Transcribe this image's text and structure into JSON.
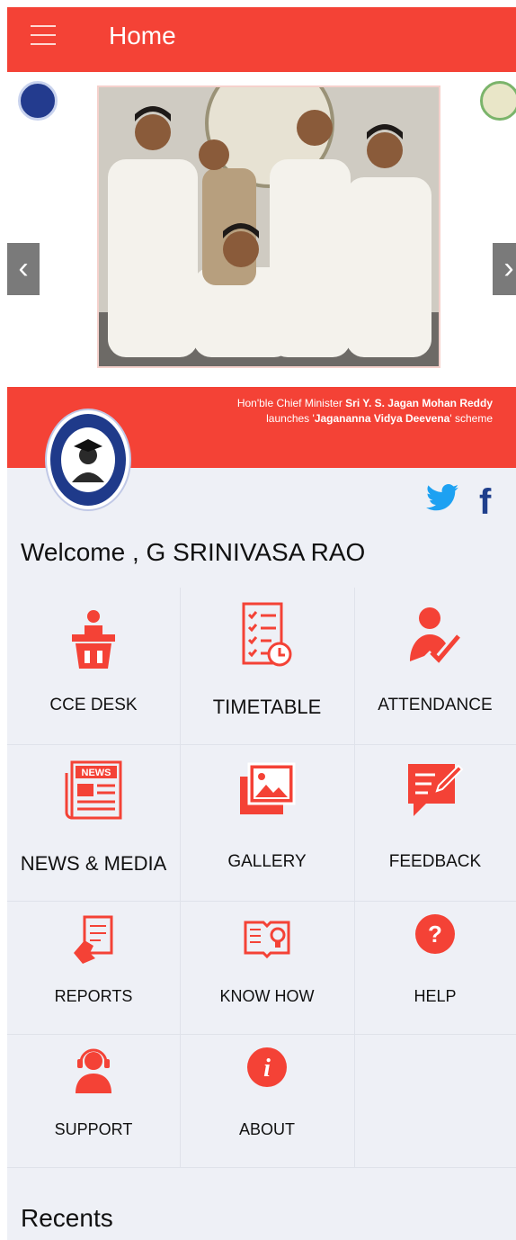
{
  "header": {
    "title": "Home"
  },
  "banner": {
    "caption_line1_prefix": "Hon'ble Chief Minister ",
    "caption_line1_name": "Sri Y. S. Jagan Mohan Reddy",
    "caption_line2_prefix": "launches '",
    "caption_line2_scheme": "Jagananna Vidya Deevena",
    "caption_line2_suffix": "' scheme"
  },
  "welcome": "Welcome , G SRINIVASA RAO",
  "menu": [
    {
      "label": "CCE DESK",
      "icon": "desk-person-icon"
    },
    {
      "label": "TIMETABLE",
      "icon": "checklist-clock-icon"
    },
    {
      "label": "ATTENDANCE",
      "icon": "person-check-icon"
    },
    {
      "label": "NEWS & MEDIA",
      "icon": "newspaper-icon"
    },
    {
      "label": "GALLERY",
      "icon": "images-icon"
    },
    {
      "label": "FEEDBACK",
      "icon": "feedback-note-icon"
    },
    {
      "label": "REPORTS",
      "icon": "report-hand-icon"
    },
    {
      "label": "KNOW HOW",
      "icon": "book-bulb-icon"
    },
    {
      "label": "HELP",
      "icon": "question-icon"
    },
    {
      "label": "SUPPORT",
      "icon": "headset-icon"
    },
    {
      "label": "ABOUT",
      "icon": "info-icon"
    }
  ],
  "recents": "Recents",
  "colors": {
    "accent": "#f44236",
    "background": "#eef0f6",
    "twitter": "#1da1f2",
    "facebook": "#1f3f8c"
  }
}
